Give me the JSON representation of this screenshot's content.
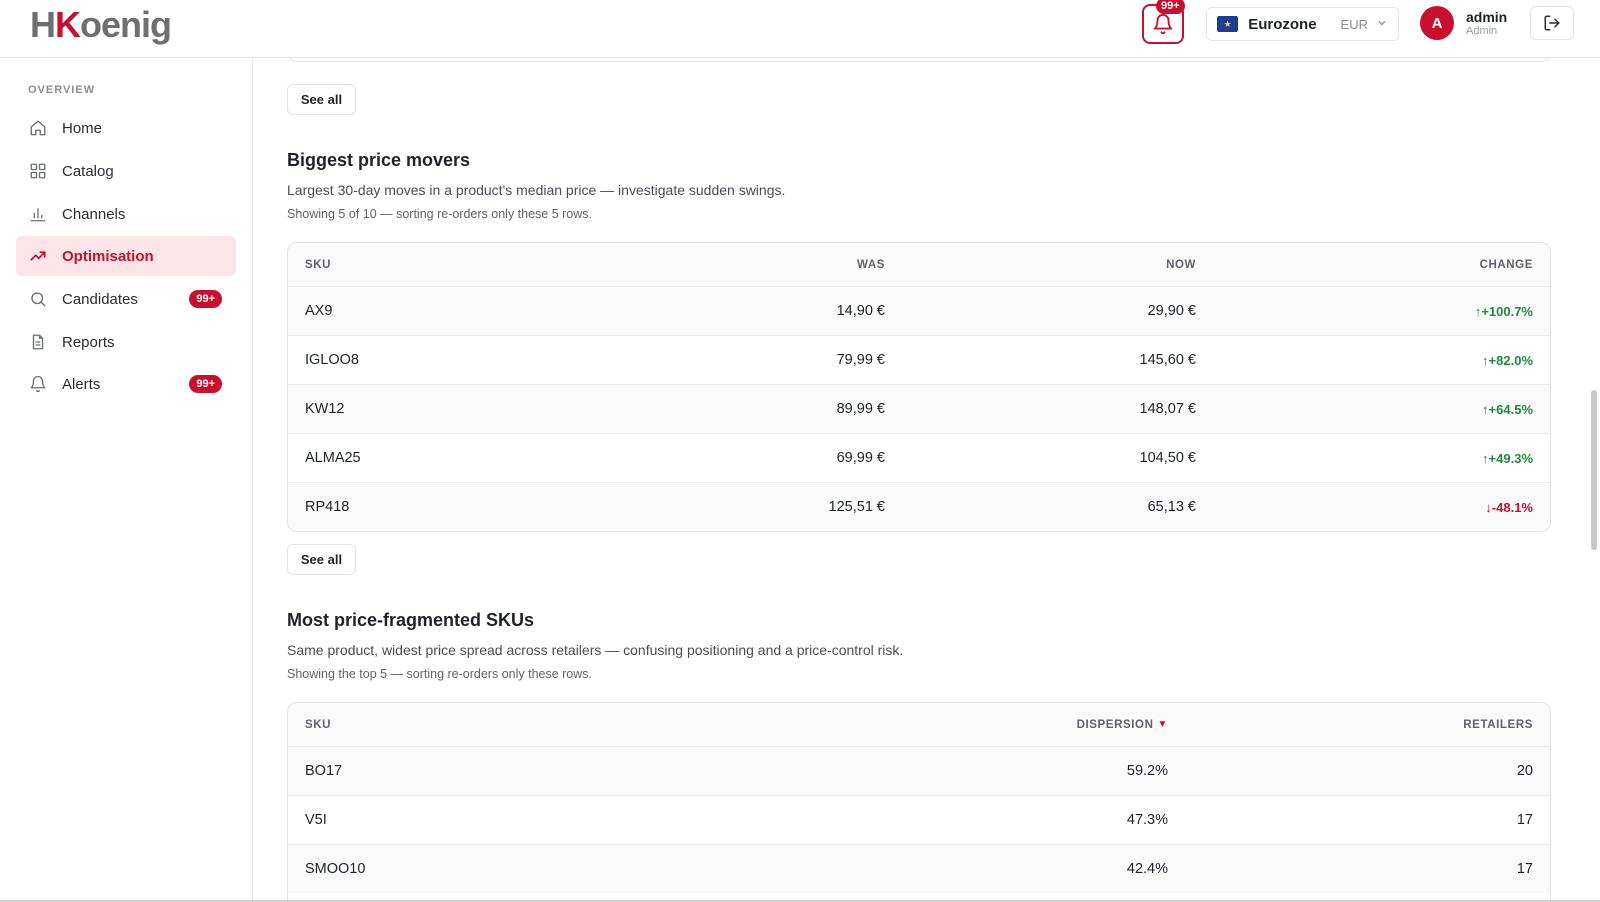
{
  "header": {
    "logo_h": "H",
    "logo_k": "K",
    "logo_rest": "oenig",
    "notifications_badge": "99+",
    "region": {
      "name": "Eurozone",
      "currency": "EUR"
    },
    "user": {
      "initial": "A",
      "name": "admin",
      "role": "Admin"
    }
  },
  "sidebar": {
    "section_label": "OVERVIEW",
    "items": [
      {
        "label": "Home",
        "icon": "home-icon",
        "active": false,
        "badge": ""
      },
      {
        "label": "Catalog",
        "icon": "grid-icon",
        "active": false,
        "badge": ""
      },
      {
        "label": "Channels",
        "icon": "bar-chart-icon",
        "active": false,
        "badge": ""
      },
      {
        "label": "Optimisation",
        "icon": "trend-up-icon",
        "active": true,
        "badge": ""
      },
      {
        "label": "Candidates",
        "icon": "search-icon",
        "active": false,
        "badge": "99+"
      },
      {
        "label": "Reports",
        "icon": "document-icon",
        "active": false,
        "badge": ""
      },
      {
        "label": "Alerts",
        "icon": "bell-icon",
        "active": false,
        "badge": "99+"
      }
    ]
  },
  "main": {
    "see_all_label": "See all",
    "movers": {
      "title": "Biggest price movers",
      "description": "Largest 30-day moves in a product's median price — investigate sudden swings.",
      "note": "Showing 5 of 10 — sorting re-orders only these 5 rows.",
      "columns": [
        "SKU",
        "WAS",
        "NOW",
        "CHANGE"
      ],
      "rows": [
        {
          "sku": "AX9",
          "was": "14,90 €",
          "now": "29,90 €",
          "change": "+100.7%",
          "direction": "up"
        },
        {
          "sku": "IGLOO8",
          "was": "79,99 €",
          "now": "145,60 €",
          "change": "+82.0%",
          "direction": "up"
        },
        {
          "sku": "KW12",
          "was": "89,99 €",
          "now": "148,07 €",
          "change": "+64.5%",
          "direction": "up"
        },
        {
          "sku": "ALMA25",
          "was": "69,99 €",
          "now": "104,50 €",
          "change": "+49.3%",
          "direction": "up"
        },
        {
          "sku": "RP418",
          "was": "125,51 €",
          "now": "65,13 €",
          "change": "-48.1%",
          "direction": "down"
        }
      ]
    },
    "fragmented": {
      "title": "Most price-fragmented SKUs",
      "description": "Same product, widest price spread across retailers — confusing positioning and a price-control risk.",
      "note": "Showing the top 5 — sorting re-orders only these rows.",
      "columns": [
        "SKU",
        "DISPERSION",
        "RETAILERS"
      ],
      "sort_indicator": "▼",
      "rows": [
        {
          "sku": "BO17",
          "dispersion": "59.2%",
          "retailers": "20"
        },
        {
          "sku": "V5I",
          "dispersion": "47.3%",
          "retailers": "17"
        },
        {
          "sku": "SMOO10",
          "dispersion": "42.4%",
          "retailers": "17"
        }
      ]
    }
  },
  "colors": {
    "brand": "#c8102e",
    "positive": "#1f8a3a",
    "negative": "#c8102e"
  }
}
